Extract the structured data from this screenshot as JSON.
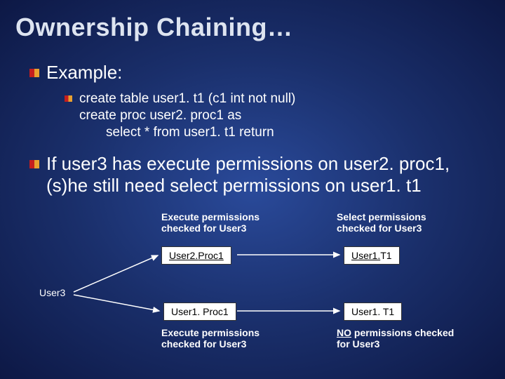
{
  "title": "Ownership Chaining…",
  "bullets": {
    "example": "Example:",
    "code_line1": "create table user1. t1 (c1 int not null)",
    "code_line2": "create proc user2. proc1 as",
    "code_line3": "select * from user1. t1 return",
    "para": "If user3 has execute permissions on user2. proc1, (s)he still need select permissions on user1. t1"
  },
  "diagram": {
    "top_left_label": "Execute permissions checked for User3",
    "top_right_label": "Select permissions checked for User3",
    "user3": "User3",
    "box_tl_prefix": "User2.",
    "box_tl_suffix": "Proc1",
    "box_tr_prefix": "User1.",
    "box_tr_suffix": "T1",
    "box_bl": "User1. Proc1",
    "box_br": "User1. T1",
    "bottom_left_label": "Execute permissions checked for User3",
    "bottom_right_prefix": "NO",
    "bottom_right_suffix": " permissions checked for User3"
  }
}
